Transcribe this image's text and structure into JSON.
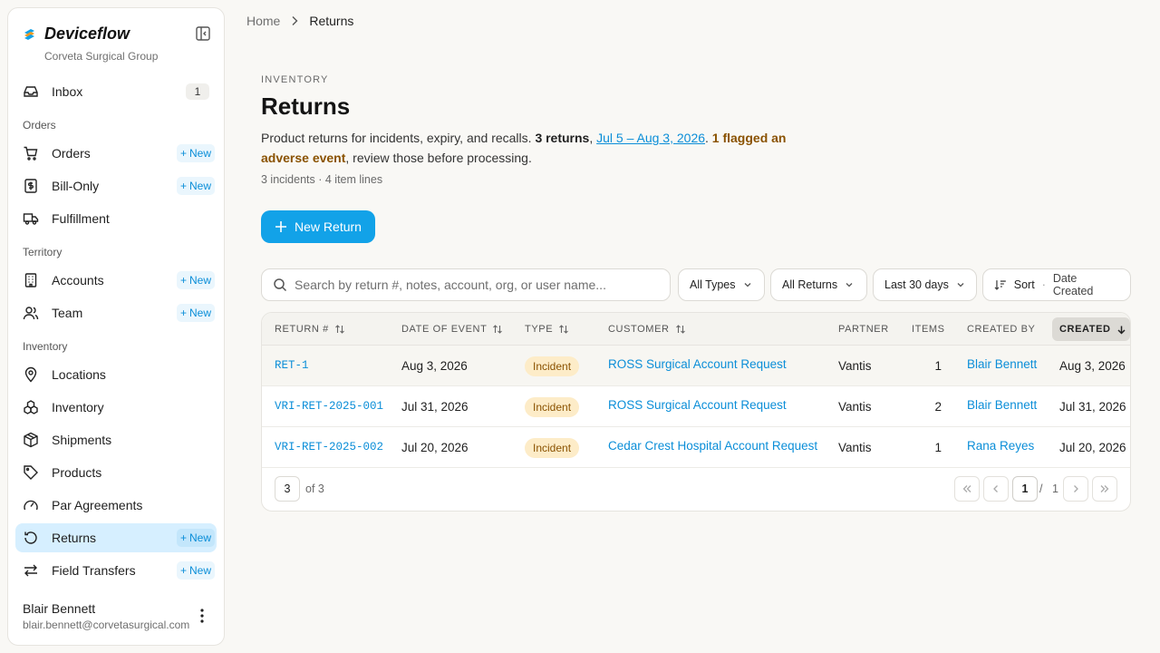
{
  "brand": {
    "name": "Deviceflow",
    "org": "Corveta Surgical Group"
  },
  "sidebar": {
    "inbox": {
      "label": "Inbox",
      "count": "1"
    },
    "sections": {
      "orders": "Orders",
      "territory": "Territory",
      "inventory": "Inventory"
    },
    "items": {
      "orders": "Orders",
      "bill_only": "Bill-Only",
      "fulfillment": "Fulfillment",
      "accounts": "Accounts",
      "team": "Team",
      "locations": "Locations",
      "inventory": "Inventory",
      "shipments": "Shipments",
      "products": "Products",
      "par_agreements": "Par Agreements",
      "returns": "Returns",
      "field_transfers": "Field Transfers"
    },
    "new_label": "New",
    "active_item": "Returns"
  },
  "user": {
    "name": "Blair Bennett",
    "email": "blair.bennett@corvetasurgical.com"
  },
  "breadcrumb": {
    "home": "Home",
    "current": "Returns"
  },
  "page": {
    "eyebrow": "INVENTORY",
    "title": "Returns",
    "desc_prefix": "Product returns for incidents, expiry, and recalls. ",
    "desc_count": "3 returns",
    "desc_comma": ", ",
    "desc_range": "Jul 5 – Aug 3, 2026",
    "desc_dot": ". ",
    "desc_flag": "1 flagged an adverse event",
    "desc_suffix": ", review those before processing.",
    "meta": "3 incidents · 4 item lines",
    "new_button": "New Return"
  },
  "toolbar": {
    "search_placeholder": "Search by return #, notes, account, org, or user name...",
    "filter_type": "All Types",
    "filter_returns": "All Returns",
    "filter_range": "Last 30 days",
    "sort_label": "Sort",
    "sort_sep": "·",
    "sort_value": "Date Created"
  },
  "table": {
    "headers": {
      "return_no": "RETURN #",
      "date_of_event": "DATE OF EVENT",
      "type": "TYPE",
      "customer": "CUSTOMER",
      "partner": "PARTNER",
      "items": "ITEMS",
      "created_by": "CREATED BY",
      "created": "CREATED"
    },
    "rows": [
      {
        "return_no": "RET-1",
        "date_of_event": "Aug 3, 2026",
        "type": "Incident",
        "customer": "ROSS Surgical Account Request",
        "partner": "Vantis",
        "items": "1",
        "created_by": "Blair Bennett",
        "created": "Aug 3, 2026"
      },
      {
        "return_no": "VRI-RET-2025-001",
        "date_of_event": "Jul 31, 2026",
        "type": "Incident",
        "customer": "ROSS Surgical Account Request",
        "partner": "Vantis",
        "items": "2",
        "created_by": "Blair Bennett",
        "created": "Jul 31, 2026"
      },
      {
        "return_no": "VRI-RET-2025-002",
        "date_of_event": "Jul 20, 2026",
        "type": "Incident",
        "customer": "Cedar Crest Hospital Account Request",
        "partner": "Vantis",
        "items": "1",
        "created_by": "Rana Reyes",
        "created": "Jul 20, 2026"
      }
    ],
    "footer": {
      "page_size": "3",
      "of_total": "of 3",
      "current_page": "1",
      "slash": "/",
      "total_pages": "1"
    }
  },
  "colors": {
    "accent": "#12a2e8",
    "active_nav": "#d6efff",
    "badge_bg": "#fdecc8",
    "badge_text": "#8a5200",
    "link": "#0b8ed8"
  }
}
